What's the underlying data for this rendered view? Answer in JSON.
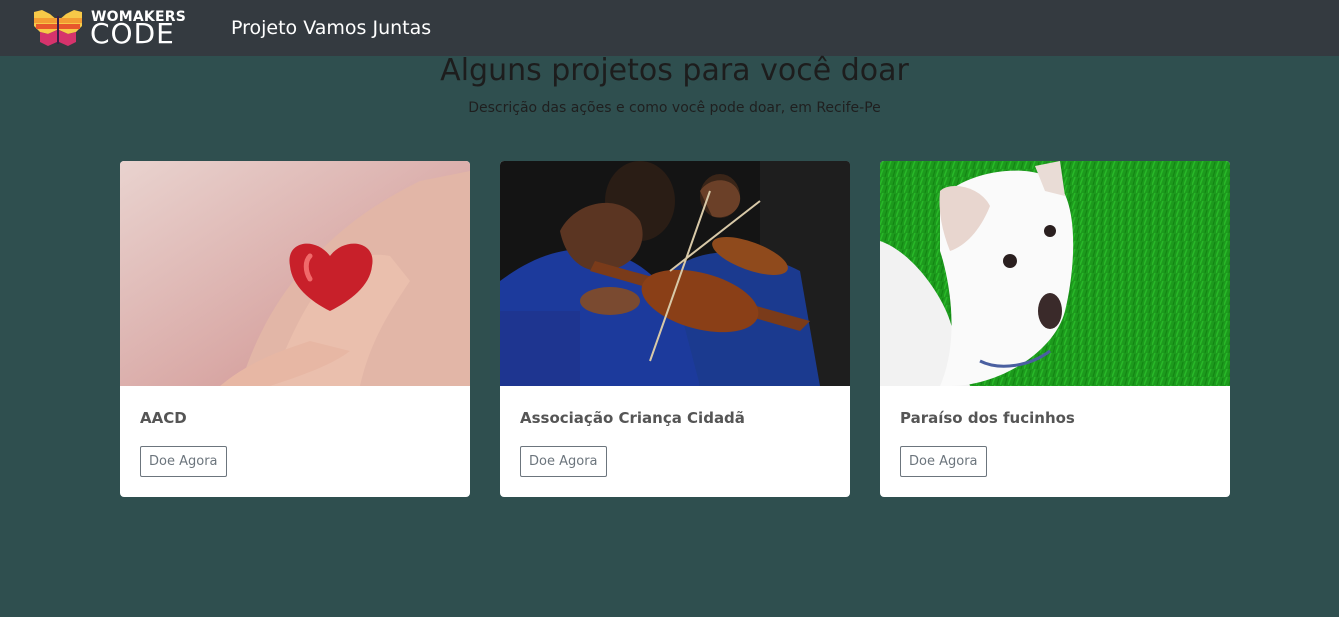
{
  "navbar": {
    "logo_top": "WOMAKERS",
    "logo_bottom": "CODE",
    "title": "Projeto Vamos Juntas"
  },
  "hero": {
    "title": "Alguns projetos para você doar",
    "subtitle": "Descrição das ações e como você pode doar, em Recife-Pe"
  },
  "cards": [
    {
      "title": "AACD",
      "button": "Doe Agora",
      "image": "heart-in-hands-photo"
    },
    {
      "title": "Associação Criança Cidadã",
      "button": "Doe Agora",
      "image": "children-violin-orchestra-photo"
    },
    {
      "title": "Paraíso dos fucinhos",
      "button": "Doe Agora",
      "image": "white-dog-on-grass-photo"
    }
  ],
  "colors": {
    "page_bg": "#2f4f4f",
    "navbar_bg": "#343a40",
    "card_bg": "#ffffff",
    "button_border": "#6c757d"
  }
}
